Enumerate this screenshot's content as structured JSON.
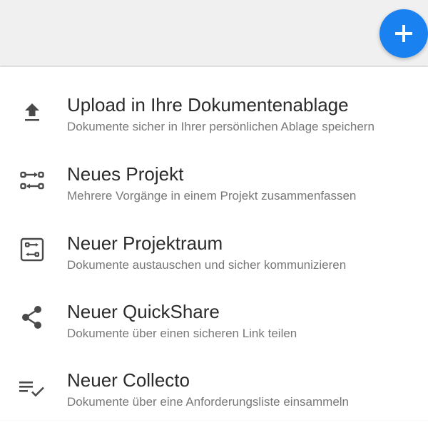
{
  "fab": {
    "icon": "plus-icon",
    "color": "#1a82f0"
  },
  "menu": {
    "items": [
      {
        "icon": "upload-icon",
        "title": "Upload in Ihre Dokumentenablage",
        "subtitle": "Dokumente sicher in Ihrer persönlichen Ablage speichern"
      },
      {
        "icon": "project-icon",
        "title": "Neues Projekt",
        "subtitle": "Mehrere Vorgänge in einem Projekt zusammenfassen"
      },
      {
        "icon": "project-room-icon",
        "title": "Neuer Projektraum",
        "subtitle": "Dokumente austauschen und sicher kommunizieren"
      },
      {
        "icon": "share-icon",
        "title": "Neuer QuickShare",
        "subtitle": "Dokumente über einen sicheren Link teilen"
      },
      {
        "icon": "checklist-icon",
        "title": "Neuer Collecto",
        "subtitle": "Dokumente über eine Anforderungsliste einsammeln"
      }
    ]
  }
}
